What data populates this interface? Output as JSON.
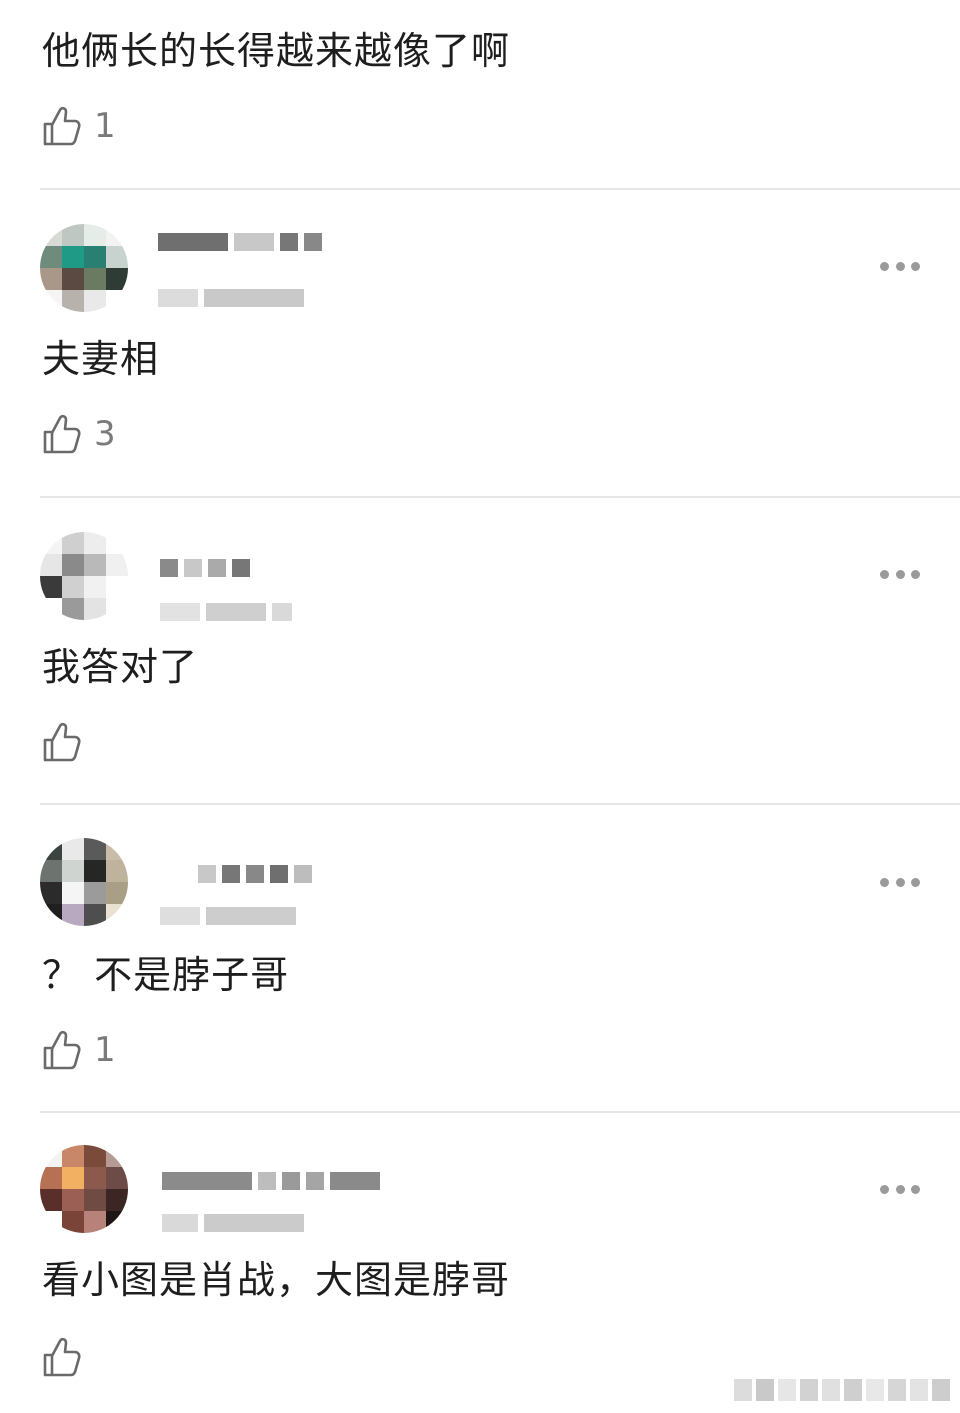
{
  "comments": [
    {
      "text": "他俩长的长得越来越像了啊",
      "likes": "1",
      "has_header": false
    },
    {
      "text": "夫妻相",
      "likes": "3",
      "has_header": true
    },
    {
      "text": "我答对了",
      "likes": "",
      "has_header": true
    },
    {
      "text": "？ 不是脖子哥",
      "likes": "1",
      "has_header": true
    },
    {
      "text": "看小图是肖战，大图是脖哥",
      "likes": "",
      "has_header": true
    }
  ],
  "icons": {
    "like": "thumbs-up-icon",
    "more": "more-options-icon"
  },
  "colors": {
    "text": "#1e1e1e",
    "meta": "#7a7a7a",
    "divider": "#e6e6e6",
    "dots": "#9a9a9a"
  }
}
